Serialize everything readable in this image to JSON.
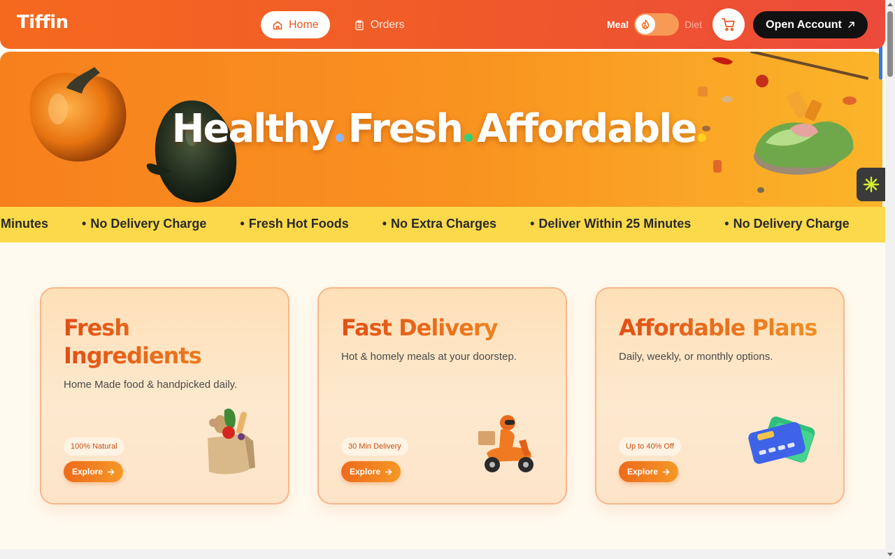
{
  "header": {
    "logo": "Tiffin",
    "nav": [
      {
        "label": "Home",
        "icon": "home-icon",
        "active": true
      },
      {
        "label": "Orders",
        "icon": "clipboard-icon",
        "active": false
      }
    ],
    "toggle": {
      "left_label": "Meal",
      "right_label": "Diet",
      "state": "Meal",
      "knob_icon": "flame-icon"
    },
    "cart_icon": "cart-icon",
    "account_label": "Open Account",
    "account_icon": "arrow-up-right-icon"
  },
  "hero": {
    "words": [
      "Healthy",
      "Fresh",
      "Affordable"
    ],
    "dot_colors": [
      "#8fb4ff",
      "#2fd07a",
      "#ffd21f"
    ],
    "bg_gradient": [
      "#f7801d",
      "#fbb52a"
    ]
  },
  "ticker": {
    "lead_fragment": "Minutes",
    "items": [
      "No Delivery Charge",
      "Fresh Hot Foods",
      "No Extra Charges",
      "Deliver Within 25 Minutes",
      "No Delivery Charge"
    ]
  },
  "cards": [
    {
      "title": "Fresh Ingredients",
      "description": "Home Made food & handpicked daily.",
      "badge": "100% Natural",
      "button": "Explore",
      "illustration": "grocery-bag-icon"
    },
    {
      "title": "Fast Delivery",
      "description": "Hot & homely meals at your doorstep.",
      "badge": "30 Min Delivery",
      "button": "Explore",
      "illustration": "delivery-scooter-icon"
    },
    {
      "title": "Affordable Plans",
      "description": "Daily, weekly, or monthly options.",
      "badge": "Up to 40% Off",
      "button": "Explore",
      "illustration": "credit-card-icon"
    }
  ],
  "colors": {
    "accent": "#ee6a1b",
    "ticker_bg": "#fbd94a",
    "dark": "#111111"
  }
}
